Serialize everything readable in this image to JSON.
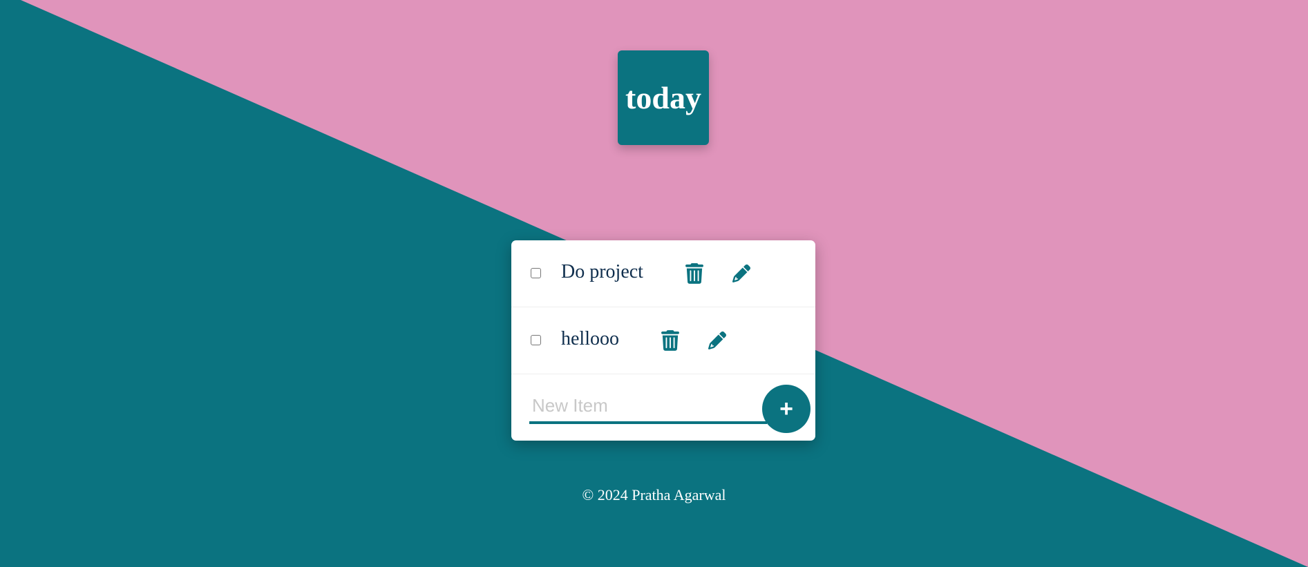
{
  "colors": {
    "background_teal": "#0b7380",
    "background_pink": "#e094bb",
    "card_background": "#ffffff",
    "text_dark": "#0f2e4d",
    "accent": "#0b7380"
  },
  "heading": {
    "title": "today"
  },
  "list": {
    "items": [
      {
        "text": "Do project",
        "checked": false,
        "delete_icon": "trash-icon",
        "edit_icon": "pencil-icon"
      },
      {
        "text": "hellooo",
        "checked": false,
        "delete_icon": "trash-icon",
        "edit_icon": "pencil-icon"
      }
    ]
  },
  "new_item": {
    "placeholder": "New Item",
    "value": "",
    "add_label": "+"
  },
  "footer": {
    "text": "© 2024 Pratha Agarwal"
  }
}
